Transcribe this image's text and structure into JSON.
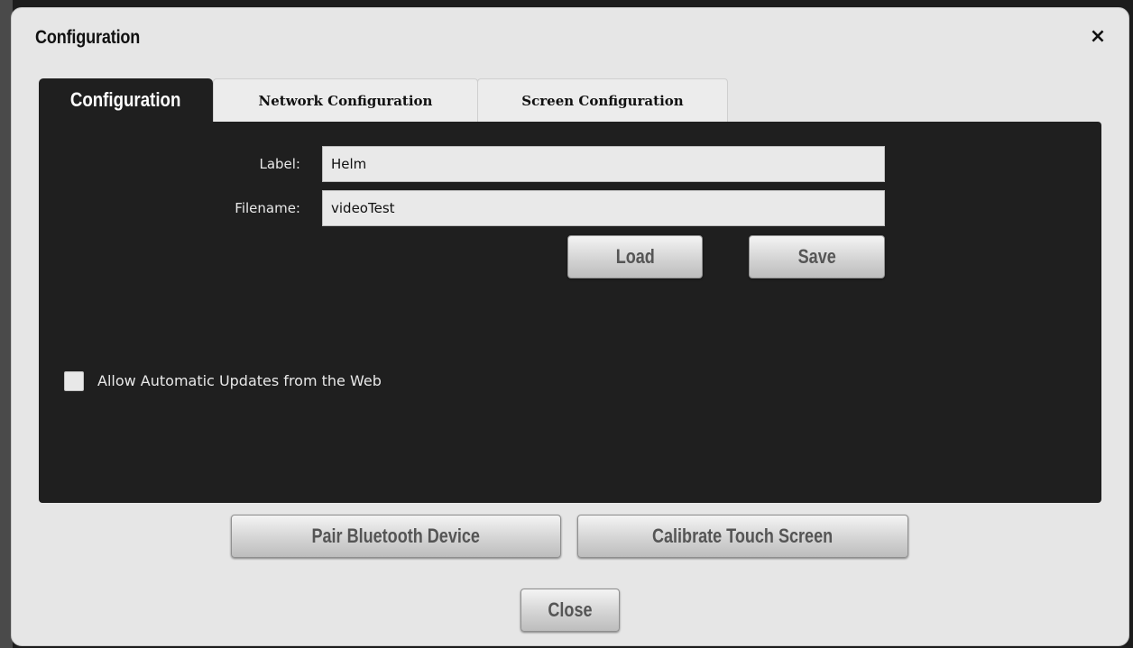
{
  "dialog": {
    "title": "Configuration",
    "close_symbol": "×"
  },
  "tabs": [
    {
      "label": "Configuration",
      "active": true
    },
    {
      "label": "Network Configuration",
      "active": false
    },
    {
      "label": "Screen Configuration",
      "active": false
    }
  ],
  "form": {
    "label_caption": "Label:",
    "label_value": "Helm",
    "filename_caption": "Filename:",
    "filename_value": "videoTest",
    "load_label": "Load",
    "save_label": "Save",
    "auto_update_label": "Allow Automatic Updates from the Web",
    "auto_update_checked": false
  },
  "footer": {
    "pair_label": "Pair Bluetooth Device",
    "calibrate_label": "Calibrate Touch Screen",
    "close_label": "Close"
  },
  "colors": {
    "panel": "#1f1f1f",
    "dialog": "#e6e6e6"
  }
}
